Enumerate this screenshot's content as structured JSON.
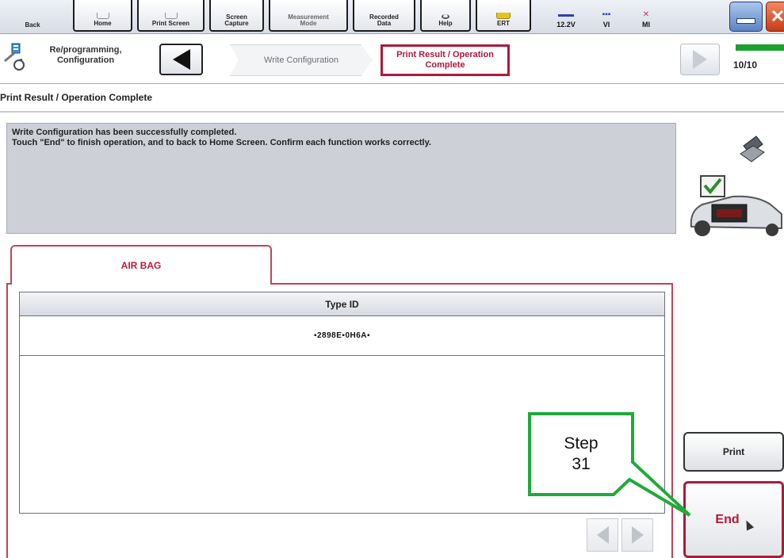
{
  "toolbar": {
    "back": "Back",
    "home": "Home",
    "print_screen": "Print Screen",
    "screen_capture": "Screen Capture",
    "measurement_mode": "Measurement Mode",
    "recorded_data": "Recorded Data",
    "help": "Help",
    "ert": "ERT",
    "voltage": "12.2V",
    "vi": "VI",
    "mi": "MI"
  },
  "breadcrumb": {
    "app_title": "Re/programming, Configuration",
    "step_prev": "Write Configuration",
    "step_current": "Print Result / Operation Complete",
    "progress": "10/10",
    "progress_fraction": 1.0
  },
  "page_title": "Print Result / Operation Complete",
  "message": {
    "line1": "Write Configuration has been successfully completed.",
    "line2": "Touch \"End\" to finish operation, and to back to Home Screen. Confirm each function works correctly."
  },
  "tab": {
    "label": "AIR BAG"
  },
  "table": {
    "header": "Type ID",
    "rows": [
      "▪2898E▪0H6A▪"
    ]
  },
  "buttons": {
    "print": "Print",
    "end": "End"
  },
  "callout": {
    "line1": "Step",
    "line2": "31",
    "border_color": "#1faa3a"
  },
  "colors": {
    "accent": "#b0183a",
    "progress": "#1aa12e"
  }
}
